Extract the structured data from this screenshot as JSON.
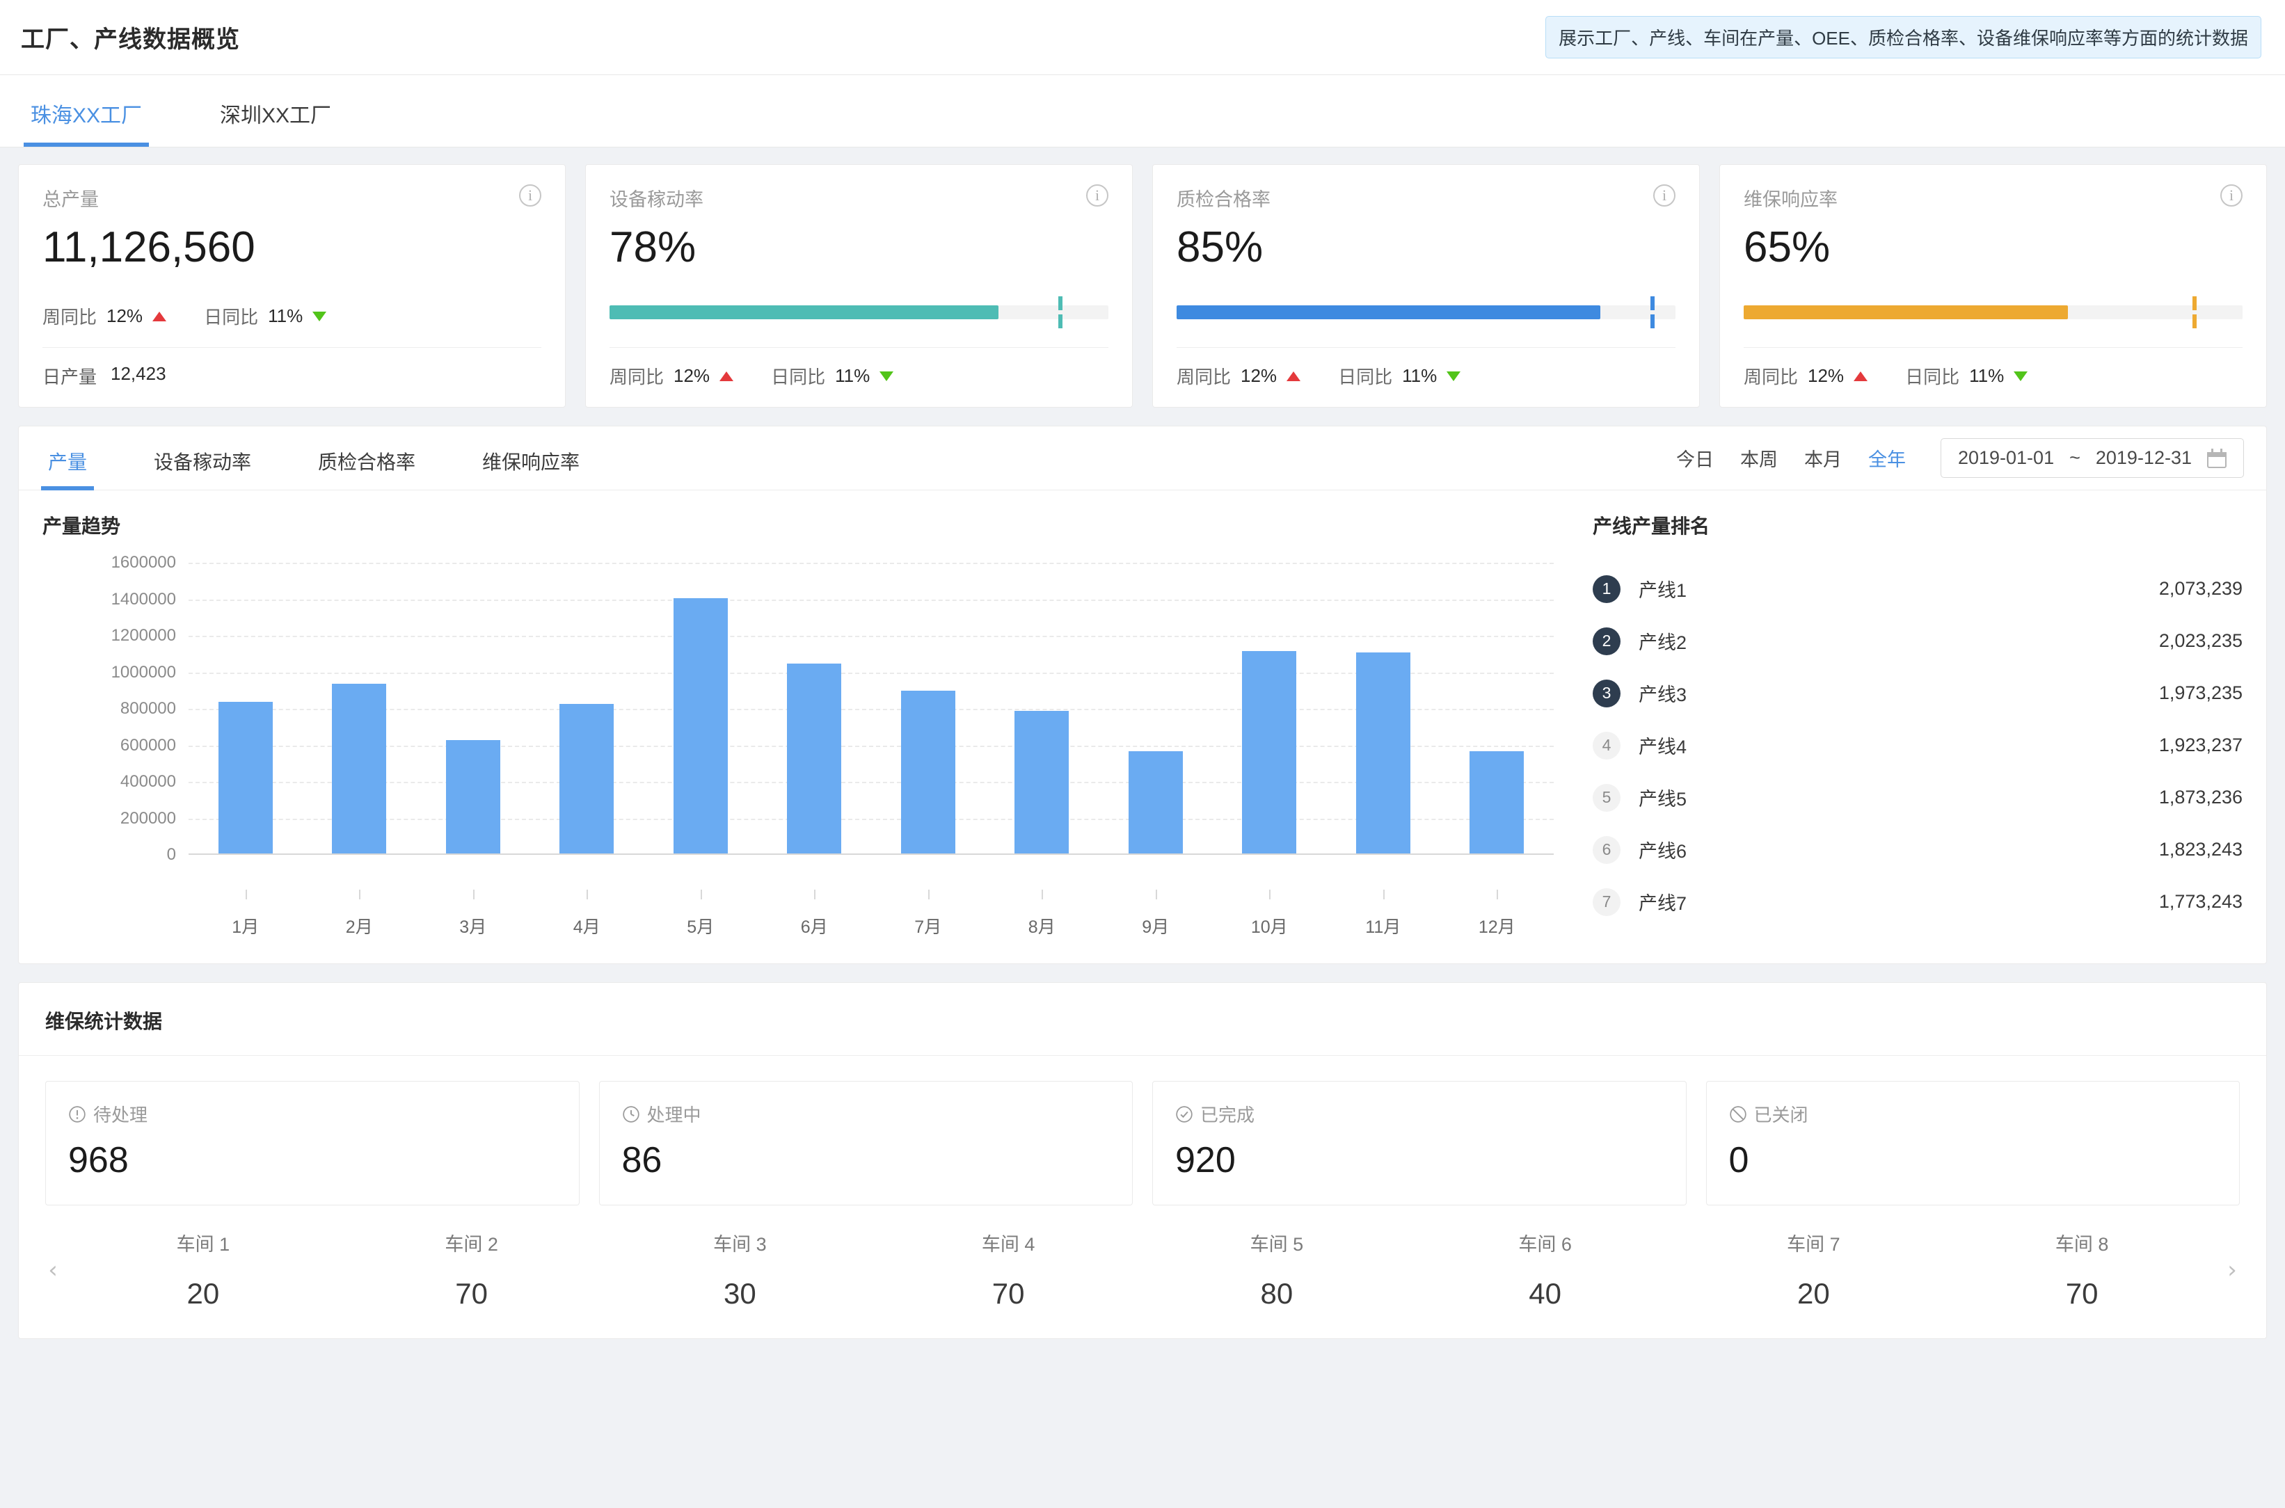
{
  "header": {
    "title": "工厂、产线数据概览",
    "info_banner": "展示工厂、产线、车间在产量、OEE、质检合格率、设备维保响应率等方面的统计数据"
  },
  "factory_tabs": [
    {
      "label": "珠海XX工厂",
      "active": true
    },
    {
      "label": "深圳XX工厂",
      "active": false
    }
  ],
  "kpi_cards": [
    {
      "label": "总产量",
      "value": "11,126,560",
      "week_label": "周同比",
      "week_value": "12%",
      "week_dir": "up",
      "day_label": "日同比",
      "day_value": "11%",
      "day_dir": "down",
      "footer_label": "日产量",
      "footer_value": "12,423",
      "bar": null
    },
    {
      "label": "设备稼动率",
      "value": "78%",
      "week_label": "周同比",
      "week_value": "12%",
      "week_dir": "up",
      "day_label": "日同比",
      "day_value": "11%",
      "day_dir": "down",
      "bar": {
        "percent": 78,
        "marker": 90,
        "color": "#4ebcb4"
      }
    },
    {
      "label": "质检合格率",
      "value": "85%",
      "week_label": "周同比",
      "week_value": "12%",
      "week_dir": "up",
      "day_label": "日同比",
      "day_value": "11%",
      "day_dir": "down",
      "bar": {
        "percent": 85,
        "marker": 95,
        "color": "#3e8ae0"
      }
    },
    {
      "label": "维保响应率",
      "value": "65%",
      "week_label": "周同比",
      "week_value": "12%",
      "week_dir": "up",
      "day_label": "日同比",
      "day_value": "11%",
      "day_dir": "down",
      "bar": {
        "percent": 65,
        "marker": 90,
        "color": "#eda931"
      }
    }
  ],
  "metric_tabs": [
    {
      "label": "产量",
      "active": true
    },
    {
      "label": "设备稼动率",
      "active": false
    },
    {
      "label": "质检合格率",
      "active": false
    },
    {
      "label": "维保响应率",
      "active": false
    }
  ],
  "periods": [
    {
      "label": "今日",
      "active": false
    },
    {
      "label": "本周",
      "active": false
    },
    {
      "label": "本月",
      "active": false
    },
    {
      "label": "全年",
      "active": true
    }
  ],
  "date_range": {
    "start": "2019-01-01",
    "separator": "~",
    "end": "2019-12-31",
    "icon": "calendar-icon"
  },
  "chart_section_title": "产量趋势",
  "rank_section_title": "产线产量排名",
  "chart_data": {
    "type": "bar",
    "title": "产量趋势",
    "categories": [
      "1月",
      "2月",
      "3月",
      "4月",
      "5月",
      "6月",
      "7月",
      "8月",
      "9月",
      "10月",
      "11月",
      "12月"
    ],
    "values": [
      830000,
      930000,
      620000,
      820000,
      1400000,
      1040000,
      890000,
      780000,
      560000,
      1110000,
      1100000,
      560000
    ],
    "xlabel": "",
    "ylabel": "",
    "ylim": [
      0,
      1600000
    ],
    "yticks": [
      0,
      200000,
      400000,
      600000,
      800000,
      1000000,
      1200000,
      1400000,
      1600000
    ],
    "ytick_labels": [
      "0",
      "200000",
      "400000",
      "600000",
      "800000",
      "1000000",
      "1200000",
      "1400000",
      "1600000"
    ],
    "grid": true,
    "legend": "none",
    "bar_color": "#6aabf2"
  },
  "ranking": [
    {
      "rank": "1",
      "name": "产线1",
      "value": "2,073,239",
      "highlight": true
    },
    {
      "rank": "2",
      "name": "产线2",
      "value": "2,023,235",
      "highlight": true
    },
    {
      "rank": "3",
      "name": "产线3",
      "value": "1,973,235",
      "highlight": true
    },
    {
      "rank": "4",
      "name": "产线4",
      "value": "1,923,237",
      "highlight": false
    },
    {
      "rank": "5",
      "name": "产线5",
      "value": "1,873,236",
      "highlight": false
    },
    {
      "rank": "6",
      "name": "产线6",
      "value": "1,823,243",
      "highlight": false
    },
    {
      "rank": "7",
      "name": "产线7",
      "value": "1,773,243",
      "highlight": false
    }
  ],
  "maintenance": {
    "title": "维保统计数据",
    "statuses": [
      {
        "label": "待处理",
        "value": "968",
        "icon": "exclamation-circle-icon"
      },
      {
        "label": "处理中",
        "value": "86",
        "icon": "clock-circle-icon"
      },
      {
        "label": "已完成",
        "value": "920",
        "icon": "check-circle-icon"
      },
      {
        "label": "已关闭",
        "value": "0",
        "icon": "ban-circle-icon"
      }
    ],
    "carousel": {
      "prev_icon": "chevron-left-icon",
      "next_icon": "chevron-right-icon",
      "items": [
        {
          "name": "车间 1",
          "value": "20"
        },
        {
          "name": "车间 2",
          "value": "70"
        },
        {
          "name": "车间 3",
          "value": "30"
        },
        {
          "name": "车间 4",
          "value": "70"
        },
        {
          "name": "车间 5",
          "value": "80"
        },
        {
          "name": "车间 6",
          "value": "40"
        },
        {
          "name": "车间 7",
          "value": "20"
        },
        {
          "name": "车间 8",
          "value": "70"
        }
      ]
    }
  }
}
